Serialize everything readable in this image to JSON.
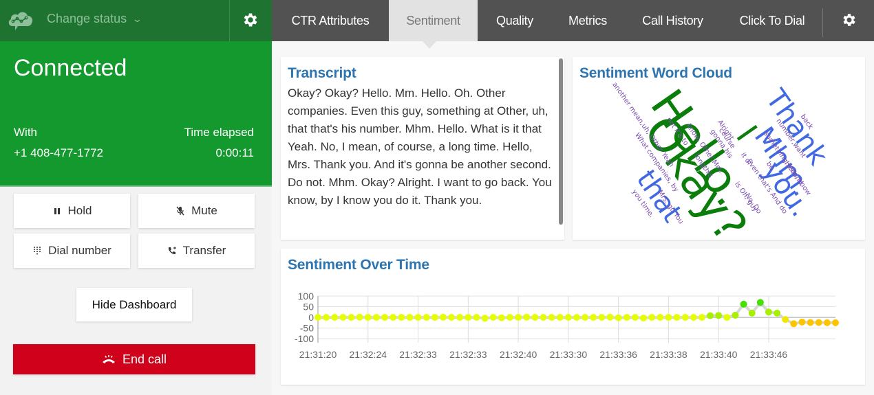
{
  "left_panel": {
    "status_dropdown_label": "Change status",
    "connection": {
      "title": "Connected",
      "with_label": "With",
      "with_value": "+1 408-477-1772",
      "time_label": "Time elapsed",
      "time_value": "0:00:11",
      "bg_color": "#14992e"
    },
    "buttons": {
      "hold": "Hold",
      "mute": "Mute",
      "dial": "Dial number",
      "transfer": "Transfer",
      "hide_dashboard": "Hide Dashboard",
      "end_call": "End call"
    }
  },
  "tabs": [
    {
      "label": "CTR Attributes",
      "active": false
    },
    {
      "label": "Sentiment",
      "active": true
    },
    {
      "label": "Quality",
      "active": false
    },
    {
      "label": "Metrics",
      "active": false
    },
    {
      "label": "Call History",
      "active": false
    },
    {
      "label": "Click To Dial",
      "active": false
    }
  ],
  "transcript": {
    "title": "Transcript",
    "text": "Okay? Okay? Hello. Mm. Hello. Oh. Other companies. Even this guy, something at Other, uh, that that's his number. Mhm. Hello. What is it that Yeah. No, I mean, of course, a long time. Hello, Mrs. Thank you. And it's gonna be another second. Do not. Mhm. Okay? Alright. I want to go back. You know, by I know you do it. Thank you."
  },
  "word_cloud": {
    "title": "Sentiment Word Cloud",
    "words": [
      {
        "text": "Okay?",
        "size": "xl",
        "color": "#0a7d0a"
      },
      {
        "text": "Hello.",
        "size": "xl",
        "color": "#0a7d0a"
      },
      {
        "text": "I",
        "size": "l",
        "color": "#0a7d0a"
      },
      {
        "text": "Thank",
        "size": "l",
        "color": "#4169e1"
      },
      {
        "text": "Mhm.",
        "size": "l",
        "color": "#4169e1"
      },
      {
        "text": "you.",
        "size": "l",
        "color": "#4169e1"
      },
      {
        "text": "that",
        "size": "l",
        "color": "#4169e1"
      },
      {
        "text": "back",
        "size": "s",
        "color": "#7b4fb0"
      },
      {
        "text": "number,want",
        "size": "s",
        "color": "#7b4fb0"
      },
      {
        "text": "something,second,",
        "size": "s",
        "color": "#7b4fb0"
      },
      {
        "text": "be",
        "size": "s",
        "color": "#7b4fb0"
      },
      {
        "text": "Hello, know",
        "size": "s",
        "color": "#7b4fb0"
      },
      {
        "text": "Alright",
        "size": "s",
        "color": "#7b4fb0"
      },
      {
        "text": "course",
        "size": "s",
        "color": "#7b4fb0"
      },
      {
        "text": "gonna his",
        "size": "s",
        "color": "#7b4fb0"
      },
      {
        "text": "know, Other,Mm.",
        "size": "s",
        "color": "#7b4fb0"
      },
      {
        "text": "longthis",
        "size": "s",
        "color": "#7b4fb0"
      },
      {
        "text": "it of",
        "size": "s",
        "color": "#7b4fb0"
      },
      {
        "text": "Even that's And do",
        "size": "s",
        "color": "#7b4fb0"
      },
      {
        "text": "is Oh, guy",
        "size": "s",
        "color": "#7b4fb0"
      },
      {
        "text": "No. Do",
        "size": "s",
        "color": "#7b4fb0"
      },
      {
        "text": "another mean,uh, Other Yeah",
        "size": "s",
        "color": "#7b4fb0"
      },
      {
        "text": "not it's to",
        "size": "s",
        "color": "#7b4fb0"
      },
      {
        "text": "What companies, by",
        "size": "s",
        "color": "#7b4fb0"
      },
      {
        "text": "Mrs. go You",
        "size": "s",
        "color": "#7b4fb0"
      },
      {
        "text": "you time.",
        "size": "s",
        "color": "#7b4fb0"
      }
    ]
  },
  "sentiment_over_time": {
    "title": "Sentiment Over Time"
  },
  "chart_data": {
    "type": "line",
    "title": "Sentiment Over Time",
    "xlabel": "",
    "ylabel": "",
    "ylim": [
      -100,
      100
    ],
    "yticks": [
      100,
      50,
      0,
      -50,
      -100
    ],
    "xtick_labels": [
      "21:31:20",
      "21:32:24",
      "21:32:33",
      "21:32:33",
      "21:32:40",
      "21:33:30",
      "21:33:36",
      "21:33:38",
      "21:33:40",
      "21:33:46"
    ],
    "points_per_tick": 6,
    "grid": true,
    "legend": "none",
    "series": [
      {
        "name": "sentiment",
        "values": [
          0,
          0,
          0,
          0,
          0,
          1,
          0,
          0,
          0,
          0,
          0,
          0,
          0,
          0,
          0,
          1,
          0,
          0,
          0,
          0,
          -4,
          0,
          -2,
          0,
          0,
          1,
          0,
          0,
          0,
          0,
          0,
          0,
          0,
          0,
          0,
          1,
          -2,
          0,
          0,
          -3,
          0,
          0,
          0,
          0,
          0,
          0,
          0,
          8,
          9,
          0,
          10,
          62,
          20,
          70,
          25,
          20,
          -10,
          -30,
          -22,
          -24,
          -24,
          -25,
          -25
        ]
      }
    ],
    "color_scale": {
      "positive": "#44e000",
      "neutral": "#e6ff00",
      "negative": "#ffc400"
    }
  }
}
